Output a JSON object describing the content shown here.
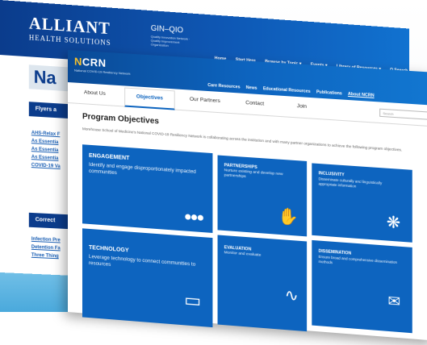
{
  "back_window": {
    "logo_main": "ALLIANT",
    "logo_sub": "HEALTH SOLUTIONS",
    "gin_qio": "GIN–QIO",
    "gin_sub": "Quality Innovation Network · Quality Improvement Organization",
    "nav": [
      "Home",
      "Start Here",
      "Browse by Topic ▾",
      "Events ▾",
      "Library of Resources ▾",
      "Q Search"
    ],
    "page_heading": "Na",
    "flyers_heading": "Flyers a",
    "links": [
      "AHS-Relax F",
      "As Essentia",
      "As Essentia",
      "As Essentia",
      "COVID-19 Va"
    ],
    "correct_heading": "Correct",
    "links2": [
      "Infection Pre",
      "Detention Fa",
      "Three Thing"
    ]
  },
  "front_window": {
    "logo_n": "N",
    "logo_rest": "CRN",
    "logo_tag": "National COVID-19 Resiliency Network",
    "nav": [
      {
        "label": "Care Resources",
        "active": false
      },
      {
        "label": "News",
        "active": false
      },
      {
        "label": "Educational Resources",
        "active": false
      },
      {
        "label": "Publications",
        "active": false
      },
      {
        "label": "About NCRN",
        "active": true
      }
    ],
    "tabs": {
      "about": "About Us",
      "objectives": "Objectives",
      "partners": "Our Partners",
      "contact": "Contact",
      "join": "Join"
    },
    "search_placeholder": "Search",
    "program_title": "Program Objectives",
    "program_subtitle": "Morehouse School of Medicine's National COVID-19 Resiliency Network is collaborating across the institution and with many partner organizations to achieve the following program objectives.",
    "tiles": {
      "engagement": {
        "title": "ENGAGEMENT",
        "desc": "Identify and engage disproportionately impacted communities"
      },
      "partnerships": {
        "title": "PARTNERSHIPS",
        "desc": "Nurture existing and develop new partnerships"
      },
      "inclusivity": {
        "title": "INCLUSIVITY",
        "desc": "Disseminate culturally and linguistically appropriate information"
      },
      "technology": {
        "title": "TECHNOLOGY",
        "desc": "Leverage technology to connect communities to resources"
      },
      "evaluation": {
        "title": "EVALUATION",
        "desc": "Monitor and evaluate"
      },
      "dissemination": {
        "title": "DISSEMINATION",
        "desc": "Ensure broad and comprehensive dissemination methods"
      }
    }
  },
  "colors": {
    "tile_blue": "#0d64bf",
    "header_blue": "#0a4a96",
    "link_blue": "#1a5fb4",
    "bottom_sky": "#4aa9dc"
  }
}
